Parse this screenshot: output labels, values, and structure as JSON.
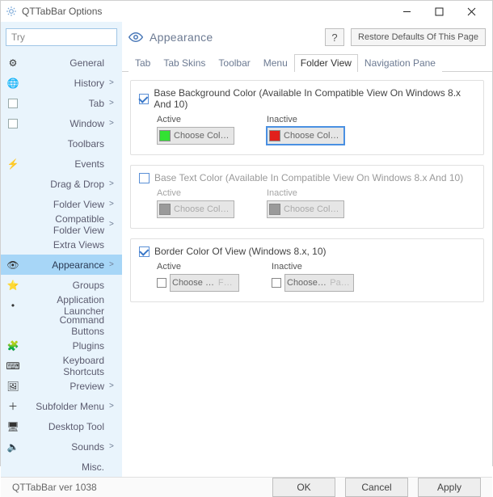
{
  "window": {
    "title": "QTTabBar Options"
  },
  "search": {
    "value": "Try"
  },
  "sidebar": {
    "items": [
      {
        "label": "General",
        "icon": "gear",
        "ext": ""
      },
      {
        "label": "History",
        "icon": "globe",
        "ext": ">"
      },
      {
        "label": "Tab",
        "icon": "checkbox",
        "ext": ">"
      },
      {
        "label": "Window",
        "icon": "checkbox",
        "ext": ">"
      },
      {
        "label": "Toolbars",
        "icon": "",
        "ext": ""
      },
      {
        "label": "Events",
        "icon": "bolt",
        "ext": ""
      },
      {
        "label": "Drag & Drop",
        "icon": "",
        "ext": ">"
      },
      {
        "label": "Folder View",
        "icon": "",
        "ext": ">"
      },
      {
        "label": "Compatible Folder View",
        "icon": "",
        "ext": ">"
      },
      {
        "label": "Extra Views",
        "icon": "",
        "ext": ""
      },
      {
        "label": "Appearance",
        "icon": "eye",
        "ext": ">"
      },
      {
        "label": "Groups",
        "icon": "star",
        "ext": ""
      },
      {
        "label": "Application Launcher",
        "icon": "dot",
        "ext": ""
      },
      {
        "label": "Command Buttons",
        "icon": "",
        "ext": ""
      },
      {
        "label": "Plugins",
        "icon": "plugin",
        "ext": ""
      },
      {
        "label": "Keyboard Shortcuts",
        "icon": "keyboard",
        "ext": ""
      },
      {
        "label": "Preview",
        "icon": "preview",
        "ext": ">"
      },
      {
        "label": "Subfolder Menu",
        "icon": "plus",
        "ext": ">"
      },
      {
        "label": "Desktop Tool",
        "icon": "desktop",
        "ext": ""
      },
      {
        "label": "Sounds",
        "icon": "sound",
        "ext": ">"
      },
      {
        "label": "Misc.",
        "icon": "",
        "ext": ""
      }
    ],
    "selected_index": 10
  },
  "page": {
    "title": "Appearance",
    "help": "?",
    "restore": "Restore Defaults Of This Page"
  },
  "sub_tabs": {
    "items": [
      "Tab",
      "Tab Skins",
      "Toolbar",
      "Menu",
      "Folder View",
      "Navigation Pane"
    ],
    "active_index": 4
  },
  "groups": {
    "base_bg": {
      "checked": true,
      "title": "Base Background Color (Available In Compatible View On Windows 8.x And 10)",
      "active": {
        "label": "Active",
        "color": "#33e233",
        "button": "Choose Color..."
      },
      "inactive": {
        "label": "Inactive",
        "color": "#e2201c",
        "button": "Choose Color..."
      }
    },
    "base_text": {
      "checked": false,
      "title": "Base Text Color (Available In Compatible View On Windows 8.x And 10)",
      "active": {
        "label": "Active",
        "color": "#9a9a9a",
        "button": "Choose Color..."
      },
      "inactive": {
        "label": "Inactive",
        "color": "#9a9a9a",
        "button": "Choose Color..."
      }
    },
    "border": {
      "checked": true,
      "title": "Border Color Of View (Windows 8.x, 10)",
      "active": {
        "label": "Active",
        "sub_checked": false,
        "button": "Choose Col",
        "hint": "For..."
      },
      "inactive": {
        "label": "Inactive",
        "sub_checked": false,
        "button": "Choose Col",
        "hint": "Pain..."
      }
    }
  },
  "footer": {
    "version": "QTTabBar ver 1038",
    "ok": "OK",
    "cancel": "Cancel",
    "apply": "Apply"
  },
  "icon_glyphs": {
    "gear": "⚙",
    "globe": "🌐",
    "bolt": "⚡",
    "eye": "👁",
    "star": "⭐",
    "dot": "•",
    "plugin": "🧩",
    "keyboard": "⌨",
    "preview": "🖼",
    "plus": "＋",
    "desktop": "🖥",
    "sound": "🔈"
  }
}
